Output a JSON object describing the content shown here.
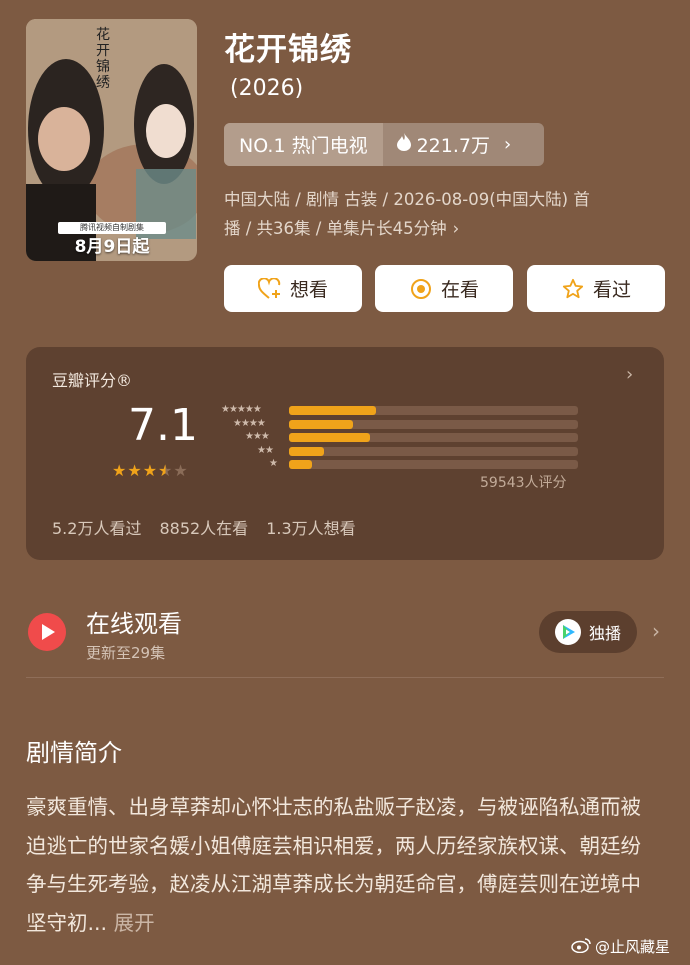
{
  "movie": {
    "title": "花开锦绣",
    "year": "(2026)",
    "rank_label": "NO.1 热门电视",
    "heat": "221.7万",
    "meta_line1": "中国大陆 / 剧情 古装 / 2026-08-09(中国大陆) 首",
    "meta_line2": "播 / 共36集 / 单集片长45分钟",
    "poster": {
      "calligraphy": "花开锦绣",
      "tag": "腾讯视频自制剧集",
      "date": "8月9日起"
    }
  },
  "actions": {
    "want": "想看",
    "watching": "在看",
    "watched": "看过"
  },
  "rating": {
    "label": "豆瓣评分®",
    "score": "7.1",
    "star_fraction": 0.71,
    "distribution_pct": [
      30,
      22,
      28,
      12,
      8
    ],
    "votes": "59543人评分",
    "watched": "5.2万人看过",
    "watching": "8852人在看",
    "want": "1.3万人想看"
  },
  "online": {
    "title": "在线观看",
    "subtitle": "更新至29集",
    "exclusive": "独播"
  },
  "synopsis": {
    "heading": "剧情简介",
    "text": "豪爽重情、出身草莽却心怀壮志的私盐贩子赵凌，与被诬陷私通而被迫逃亡的世家名媛小姐傅庭芸相识相爱，两人历经家族权谋、朝廷纷争与生死考验，赵凌从江湖草莽成长为朝廷命官，傅庭芸则在逆境中坚守初...",
    "expand": "展开"
  },
  "watermark": "@止风藏星",
  "colors": {
    "background": "#7d5a42",
    "card": "#5e4130",
    "bar": "#f0a31a",
    "play": "#f04b4b"
  }
}
